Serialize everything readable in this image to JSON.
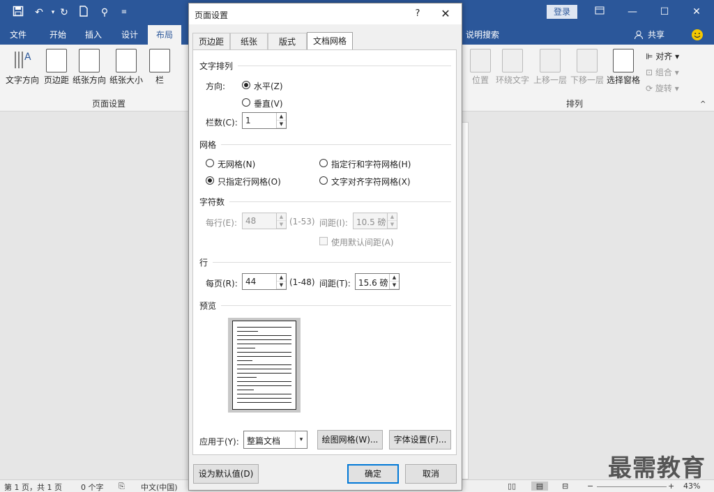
{
  "titlebar": {
    "login_label": "登录",
    "quick_access_icons": [
      "save-icon",
      "undo-icon",
      "redo-icon",
      "new-doc-icon",
      "touch-mode-icon",
      "customize-icon"
    ],
    "color": "#2b579a"
  },
  "menu": {
    "items": [
      "文件",
      "开始",
      "插入",
      "设计",
      "布局"
    ],
    "active": "布局",
    "tell_me": "说明搜索",
    "share": "共享"
  },
  "ribbon": {
    "page_setup_buttons": [
      "文字方向",
      "页边距",
      "纸张方向",
      "纸张大小",
      "栏"
    ],
    "page_setup_group": "页面设置",
    "arrange_buttons": [
      "位置",
      "环绕文字",
      "上移一层",
      "下移一层",
      "选择窗格"
    ],
    "arrange_small": [
      "对齐",
      "组合",
      "旋转"
    ],
    "arrange_group": "排列"
  },
  "dialog": {
    "title": "页面设置",
    "help": "?",
    "tabs": [
      "页边距",
      "纸张",
      "版式",
      "文档网格"
    ],
    "selected_tab": "文档网格",
    "text_layout": {
      "section": "文字排列",
      "direction_label": "方向:",
      "horizontal": "水平(Z)",
      "vertical": "垂直(V)",
      "columns_label": "栏数(C):",
      "columns_value": "1"
    },
    "grid": {
      "section": "网格",
      "options": [
        "无网格(N)",
        "只指定行网格(O)",
        "指定行和字符网格(H)",
        "文字对齐字符网格(X)"
      ],
      "selected": "只指定行网格(O)"
    },
    "chars": {
      "section": "字符数",
      "per_line_label": "每行(E):",
      "per_line_value": "48",
      "per_line_range": "(1-53)",
      "pitch_label": "间距(I):",
      "pitch_value": "10.5 磅",
      "use_default": "使用默认间距(A)"
    },
    "lines": {
      "section": "行",
      "per_page_label": "每页(R):",
      "per_page_value": "44",
      "per_page_range": "(1-48)",
      "pitch_label": "间距(T):",
      "pitch_value": "15.6 磅"
    },
    "preview": {
      "section": "预览"
    },
    "apply_label": "应用于(Y):",
    "apply_value": "整篇文档",
    "draw_grid_button": "绘图网格(W)...",
    "font_settings_button": "字体设置(F)...",
    "set_default_button": "设为默认值(D)",
    "ok_button": "确定",
    "cancel_button": "取消"
  },
  "status": {
    "page": "第 1 页，共 1 页",
    "words": "0 个字",
    "language": "中文(中国)",
    "zoom": "43%"
  },
  "watermark": "最需教育"
}
